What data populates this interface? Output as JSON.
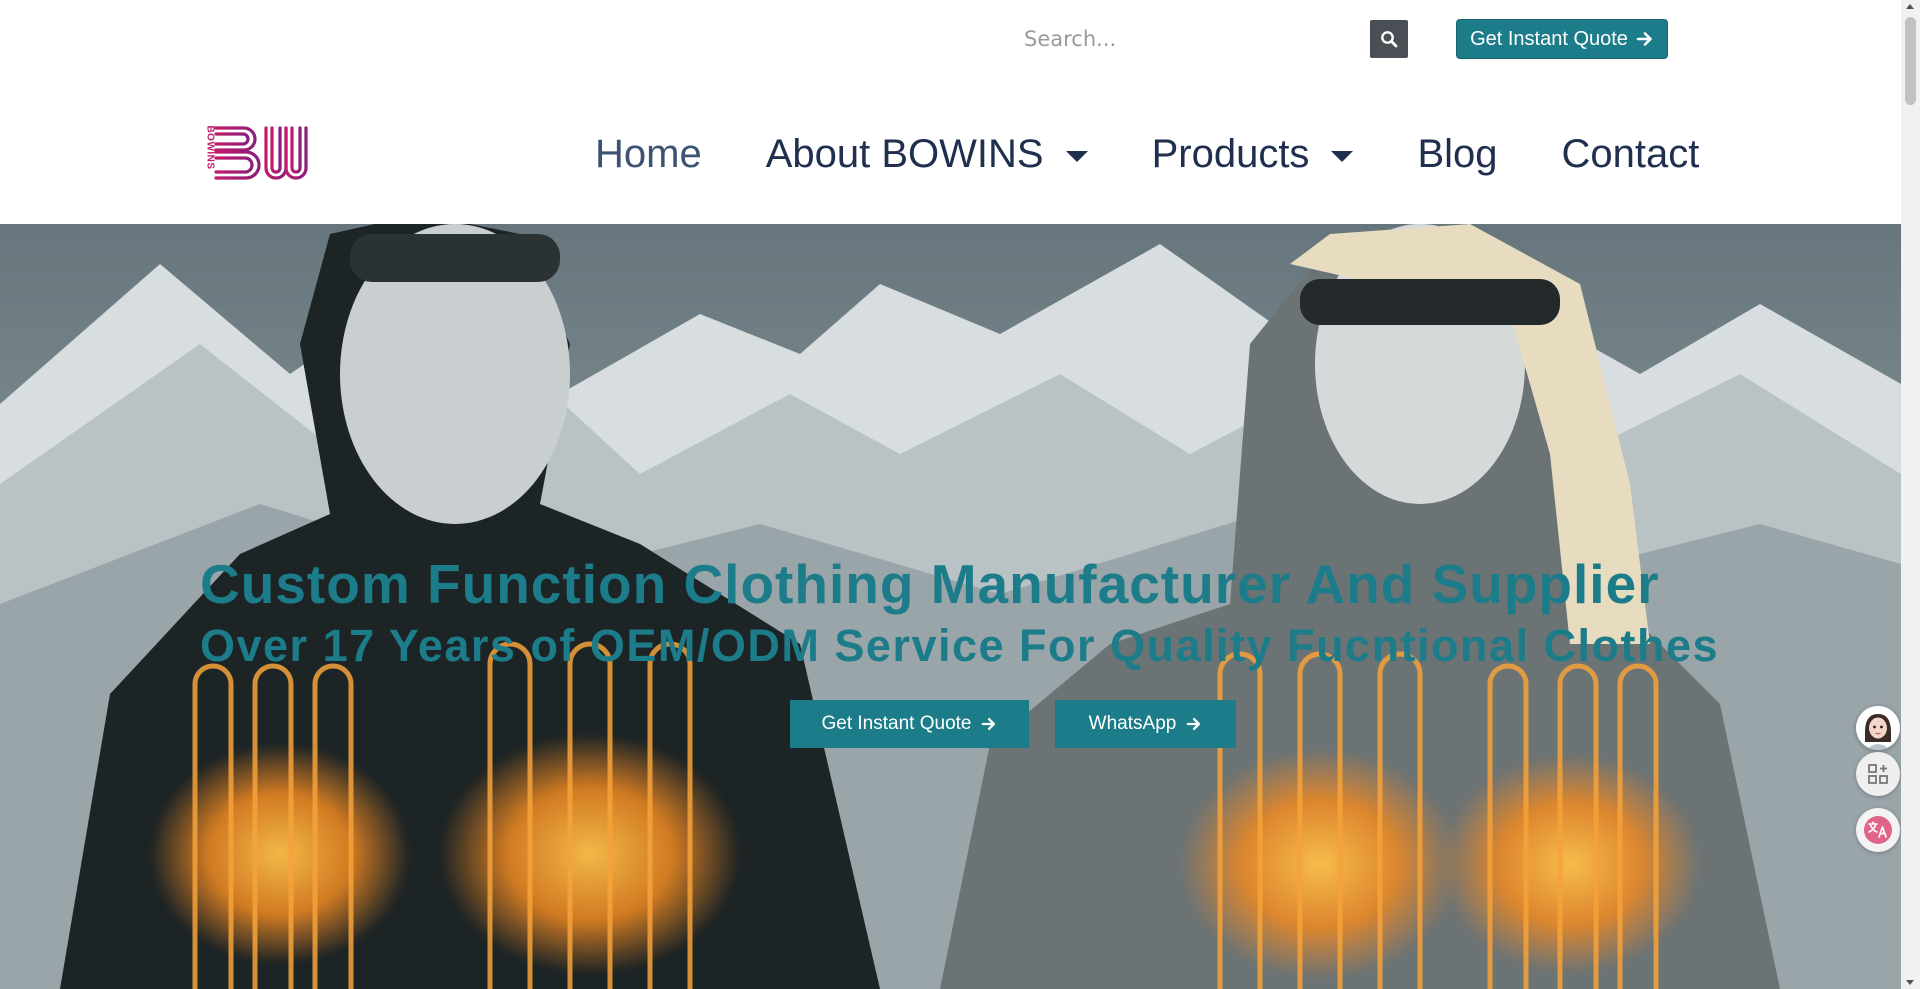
{
  "search": {
    "placeholder": "Search..."
  },
  "header": {
    "quote_button_label": "Get Instant Quote"
  },
  "logo": {
    "text": "BOWINS",
    "colors": {
      "primary": "#c11b6a",
      "secondary": "#8a1f7a"
    }
  },
  "nav": {
    "items": [
      {
        "label": "Home"
      },
      {
        "label": "About BOWINS"
      },
      {
        "label": "Products"
      },
      {
        "label": "Blog"
      },
      {
        "label": "Contact"
      }
    ]
  },
  "hero": {
    "title": "Custom Function Clothing Manufacturer And Supplier",
    "subtitle": "Over 17 Years of OEM/ODM Service For Quality Fucntional Clothes",
    "buttons": {
      "quote_label": "Get Instant Quote",
      "whatsapp_label": "WhatsApp"
    }
  },
  "colors": {
    "accent": "#1c7c89",
    "nav_text": "#1f2f4d",
    "search_button": "#4a4f55"
  },
  "icons": {
    "search": "search-icon",
    "arrow": "arrow-right-icon",
    "caret": "caret-down-icon",
    "avatar": "support-avatar-icon",
    "apps": "apps-grid-icon",
    "translate": "translate-icon"
  }
}
